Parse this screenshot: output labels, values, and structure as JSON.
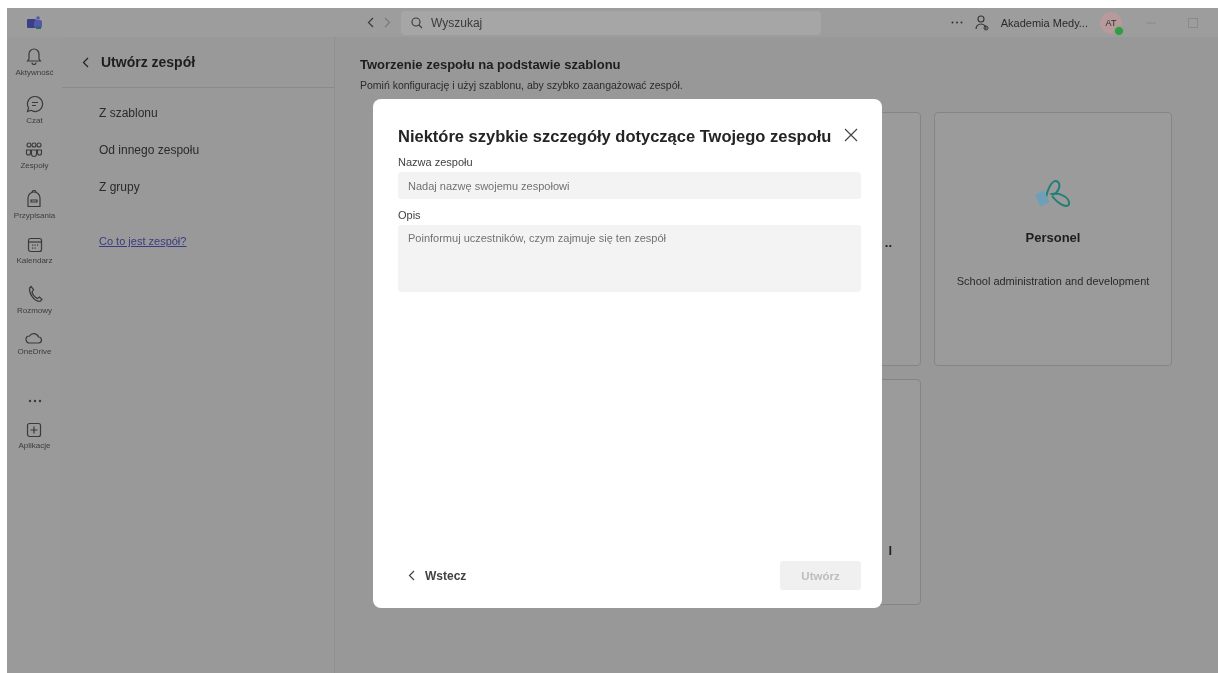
{
  "title_bar": {
    "search": {
      "placeholder": "Wyszukaj"
    },
    "account": "Akademia Medy...",
    "avatar": {
      "initials": "AT",
      "color": "#2e9e3e"
    }
  },
  "rail": [
    {
      "label": "Aktywność"
    },
    {
      "label": "Czat"
    },
    {
      "label": "Zespoły"
    },
    {
      "label": "Przypisania"
    },
    {
      "label": "Kalendarz"
    },
    {
      "label": "Rozmowy"
    },
    {
      "label": "OneDrive"
    },
    {
      "kind": "more"
    },
    {
      "label": "Aplikacje"
    }
  ],
  "panel": {
    "title": "Utwórz zespół",
    "items": [
      "Z szablonu",
      "Od innego zespołu",
      "Z grupy"
    ],
    "link": "Co to jest zespół?"
  },
  "main": {
    "title": "Tworzenie zespołu na podstawie szablonu",
    "subtitle": "Pomiń konfigurację i użyj szablonu, aby szybko zaangażować zespół.",
    "cards": [
      {
        "fragment": ".."
      },
      {
        "title": "Personel",
        "description": "School administration and development"
      },
      {
        "fragment": "l"
      }
    ]
  },
  "dialog": {
    "title": "Niektóre szybkie szczegóły dotyczące Twojego zespołu",
    "fields": [
      {
        "label": "Nazwa zespołu",
        "placeholder": "Nadaj nazwę swojemu zespołowi",
        "kind": "input"
      },
      {
        "label": "Opis",
        "placeholder": "Poinformuj uczestników, czym zajmuje się ten zespół",
        "kind": "textarea"
      }
    ],
    "back": "Wstecz",
    "create": {
      "label": "Utwórz",
      "disabled": true
    }
  }
}
